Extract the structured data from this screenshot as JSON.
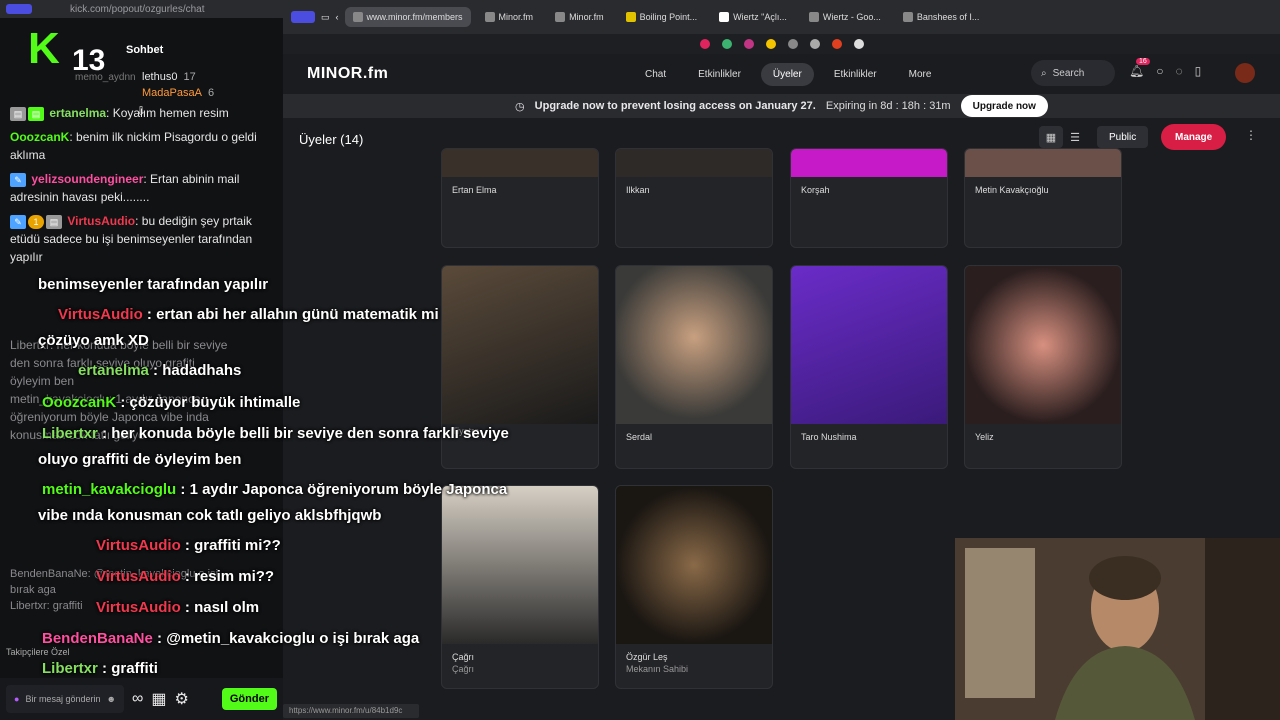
{
  "kick": {
    "url": "kick.com/popout/ozgurles/chat",
    "logo": "K",
    "viewer_count": "13",
    "title": "Sohbet",
    "faded_user": "memo_aydnn",
    "gifters": [
      {
        "name": "lethus0",
        "count": "17"
      },
      {
        "name": "MadaPasaA",
        "count": "6"
      }
    ],
    "pinned": "",
    "messages": [
      {
        "user": "ertanelma",
        "text": "Koyalım hemen resim",
        "color": "#86e060"
      },
      {
        "user": "OoozcanK",
        "text": "benim ilk nickim Pisagordu o geldi aklıma",
        "color": "#53fc18"
      },
      {
        "user": "yelizsoundengineer",
        "text": "Ertan abinin mail adresinin havası peki........",
        "color": "#ff4fa1"
      },
      {
        "user": "VirtusAudio",
        "text": "bu dediğin şey prtaik etüdü sadece bu işi benimseyenler tarafından yapılır",
        "color": "#f0384e"
      }
    ],
    "faded_lines": [
      "Libertxr: her konuda böyle belli bir seviye",
      "den sonra farklı seviye oluyo grafiti",
      "öyleyim ben",
      "metin_kavakcioglu: 1 aydır Japonca",
      "öğreniyorum böyle Japonca vibe inda",
      "konusman cok tatlı geliyo"
    ],
    "bottom_lines": [
      "BendenBanaNe: @metin_kavakcioglu o işi",
      "bırak aga",
      "Libertxr: graffiti"
    ],
    "follower_label": "Takipçilere Özel",
    "input_placeholder": "Bir mesaj gönderin",
    "send_label": "Gönder"
  },
  "browser": {
    "tabs": [
      {
        "label": "www.minor.fm/members",
        "active": true
      },
      {
        "label": "Minor.fm"
      },
      {
        "label": "Minor.fm"
      },
      {
        "label": "Boiling Point..."
      },
      {
        "label": "Wiertz \"Açlı..."
      },
      {
        "label": "Wiertz - Goo..."
      },
      {
        "label": "Banshees of I..."
      }
    ],
    "status_url": "https://www.minor.fm/u/84b1d9c"
  },
  "site": {
    "logo": "MINOR.fm",
    "menu": [
      "Chat",
      "Etkinlikler",
      "Üyeler",
      "Etkinlikler",
      "More"
    ],
    "search": "Search",
    "notif_count": "16",
    "banner_text": "Upgrade now to prevent losing access on January 27.",
    "banner_expiry": "Expiring in 8d : 18h : 31m",
    "upgrade_btn": "Upgrade now",
    "members_title": "Üyeler (14)",
    "public_btn": "Public",
    "manage_btn": "Manage"
  },
  "members": [
    {
      "name": "Ertan Elma",
      "sub": ""
    },
    {
      "name": "Ilkkan",
      "sub": ""
    },
    {
      "name": "Korşah",
      "sub": ""
    },
    {
      "name": "Metin Kavakçıoğlu",
      "sub": ""
    },
    {
      "name": "",
      "sub": "Tiyatro"
    },
    {
      "name": "Serdal",
      "sub": ""
    },
    {
      "name": "Taro Nushima",
      "sub": ""
    },
    {
      "name": "Yeliz",
      "sub": ""
    },
    {
      "name": "Çağrı",
      "sub": "Çağrı"
    },
    {
      "name": "Özgür Leş",
      "sub": "Mekanın Sahibi"
    }
  ],
  "overlay": [
    {
      "user": "",
      "text": "benimseyenler tarafından yapılır",
      "color": "#ffffff"
    },
    {
      "user": "VirtusAudio",
      "text": ": ertan abi her allahın günü matematik mi",
      "color": "#f0384e"
    },
    {
      "user": "",
      "text": "çözüyo amk XD",
      "color": "#ffffff"
    },
    {
      "user": "ertanelma",
      "text": ": hadadhahs",
      "color": "#86e060"
    },
    {
      "user": "OoozcanK",
      "text": ": çözüyor büyük ihtimalle",
      "color": "#53fc18"
    },
    {
      "user": "Libertxr",
      "text": ": her konuda böyle belli bir seviye den sonra farklı seviye",
      "color": "#86e060"
    },
    {
      "user": "",
      "text": "oluyo graffiti de öyleyim ben",
      "color": "#ffffff"
    },
    {
      "user": "metin_kavakcioglu",
      "text": ": 1 aydır Japonca öğreniyorum böyle Japonca",
      "color": "#53fc18"
    },
    {
      "user": "",
      "text": "vibe ında konusman cok tatlı geliyo aklsbfhjqwb",
      "color": "#ffffff"
    },
    {
      "user": "VirtusAudio",
      "text": ": graffiti mi??",
      "color": "#f0384e"
    },
    {
      "user": "VirtusAudio",
      "text": ": resim mi??",
      "color": "#f0384e"
    },
    {
      "user": "VirtusAudio",
      "text": ": nasıl olm",
      "color": "#f0384e"
    },
    {
      "user": "BendenBanaNe",
      "text": ": @metin_kavakcioglu o işi bırak aga",
      "color": "#ff4fa1"
    },
    {
      "user": "Libertxr",
      "text": ": graffiti",
      "color": "#86e060"
    }
  ]
}
